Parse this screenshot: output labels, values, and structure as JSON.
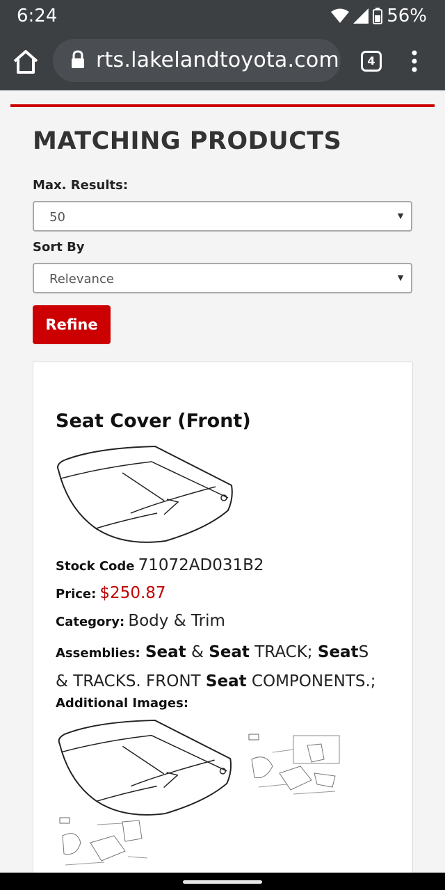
{
  "status_bar": {
    "time": "6:24",
    "battery": "56%"
  },
  "browser": {
    "url": "rts.lakelandtoyota.com",
    "tab_count": "4"
  },
  "page": {
    "heading": "MATCHING PRODUCTS",
    "max_results": {
      "label": "Max. Results:",
      "value": "50"
    },
    "sort_by": {
      "label": "Sort By",
      "value": "Relevance"
    },
    "refine_label": "Refine",
    "accent_color": "#cc0000"
  },
  "product": {
    "title": "Seat Cover (Front)",
    "stock_code": {
      "label": "Stock Code",
      "value": "71072AD031B2"
    },
    "price": {
      "label": "Price:",
      "value": "$250.87"
    },
    "category": {
      "label": "Category:",
      "value": "Body & Trim"
    },
    "assemblies": {
      "label": "Assemblies:",
      "parts": [
        "Seat",
        " & ",
        "Seat",
        " TRACK; ",
        "Seat",
        "S & TRACKS. FRONT ",
        "Seat",
        " COMPONENTS.;"
      ]
    },
    "additional_images_label": "Additional Images:"
  }
}
